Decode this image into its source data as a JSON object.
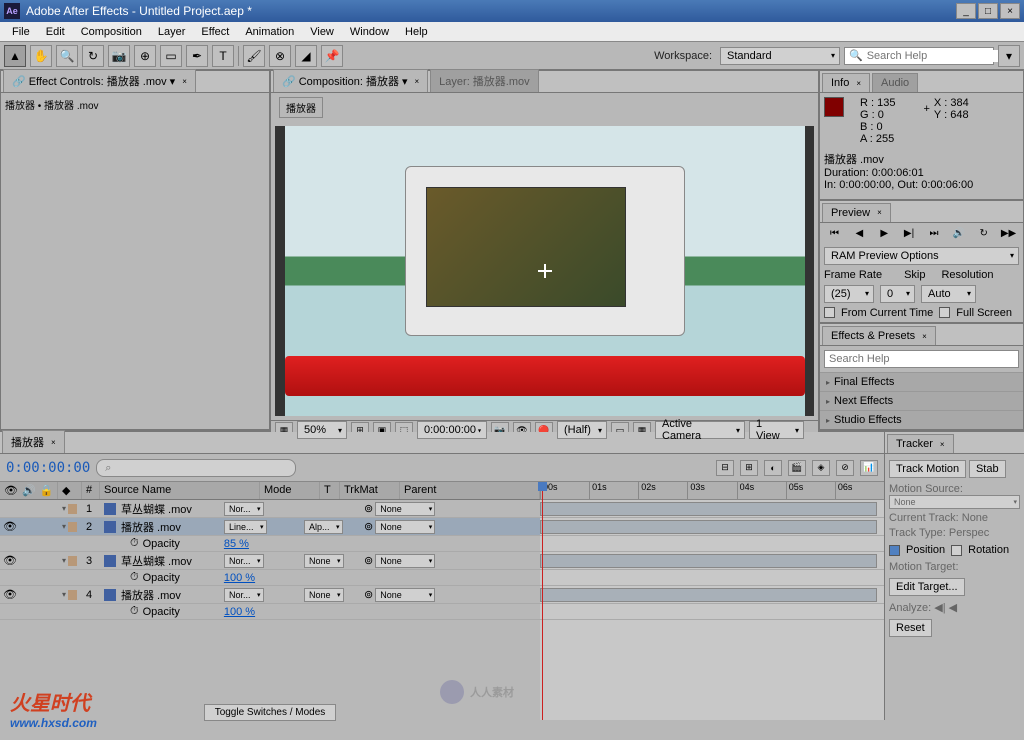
{
  "title": "Adobe After Effects - Untitled Project.aep *",
  "menu": [
    "File",
    "Edit",
    "Composition",
    "Layer",
    "Effect",
    "Animation",
    "View",
    "Window",
    "Help"
  ],
  "workspace": {
    "label": "Workspace:",
    "value": "Standard"
  },
  "search_help": "Search Help",
  "effect_controls": {
    "tab": "Effect Controls: 播放器 .mov",
    "breadcrumb": "播放器 • 播放器 .mov"
  },
  "composition": {
    "tab": "Composition: 播放器",
    "layer_tab": "Layer: 播放器.mov",
    "sub_tab": "播放器"
  },
  "comp_footer": {
    "zoom": "50%",
    "time": "0:00:00:00",
    "res": "(Half)",
    "camera": "Active Camera",
    "view": "1 View"
  },
  "info": {
    "tab": "Info",
    "tab2": "Audio",
    "r": "R : 135",
    "g": "G : 0",
    "b": "B : 0",
    "a": "A : 255",
    "x": "X : 384",
    "y": "Y : 648",
    "name": "播放器 .mov",
    "duration": "Duration: 0:00:06:01",
    "inout": "In: 0:00:00:00, Out: 0:00:06:00"
  },
  "preview": {
    "tab": "Preview",
    "ram": "RAM Preview Options",
    "fr_lbl": "Frame Rate",
    "fr": "(25)",
    "skip_lbl": "Skip",
    "skip": "0",
    "res_lbl": "Resolution",
    "res": "Auto",
    "from_current": "From Current Time",
    "full": "Full Screen"
  },
  "fx": {
    "tab": "Effects & Presets",
    "items": [
      "Final Effects",
      "Next Effects",
      "Studio Effects"
    ]
  },
  "timeline": {
    "tab": "播放器",
    "timecode": "0:00:00:00",
    "cols": {
      "num": "#",
      "src": "Source Name",
      "mode": "Mode",
      "t": "T",
      "trk": "TrkMat",
      "parent": "Parent"
    },
    "times": [
      "00s",
      "01s",
      "02s",
      "03s",
      "04s",
      "05s",
      "06s"
    ],
    "opacity_lbl": "Opacity",
    "layers": [
      {
        "n": "1",
        "name": "草丛蝴蝶 .mov",
        "mode": "Nor...",
        "trk": "",
        "parent": "None",
        "opacity": null
      },
      {
        "n": "2",
        "name": "播放器 .mov",
        "mode": "Line...",
        "trk": "Alp...",
        "parent": "None",
        "opacity": "85 %",
        "sel": true
      },
      {
        "n": "3",
        "name": "草丛蝴蝶 .mov",
        "mode": "Nor...",
        "trk": "None",
        "parent": "None",
        "opacity": "100 %"
      },
      {
        "n": "4",
        "name": "播放器 .mov",
        "mode": "Nor...",
        "trk": "None",
        "parent": "None",
        "opacity": "100 %"
      }
    ],
    "toggle": "Toggle Switches / Modes"
  },
  "tracker": {
    "tab": "Tracker",
    "track_motion": "Track Motion",
    "stab": "Stab",
    "motion_src": "Motion Source:",
    "none": "None",
    "cur_track": "Current Track:",
    "track_type": "Track Type:",
    "persp": "Perspec",
    "position": "Position",
    "rotation": "Rotation",
    "motion_target": "Motion Target:",
    "edit": "Edit Target...",
    "analyze": "Analyze:",
    "reset": "Reset"
  },
  "watermark": {
    "brand": "火星时代",
    "url": "www.hxsd.com",
    "center": "人人素材"
  }
}
